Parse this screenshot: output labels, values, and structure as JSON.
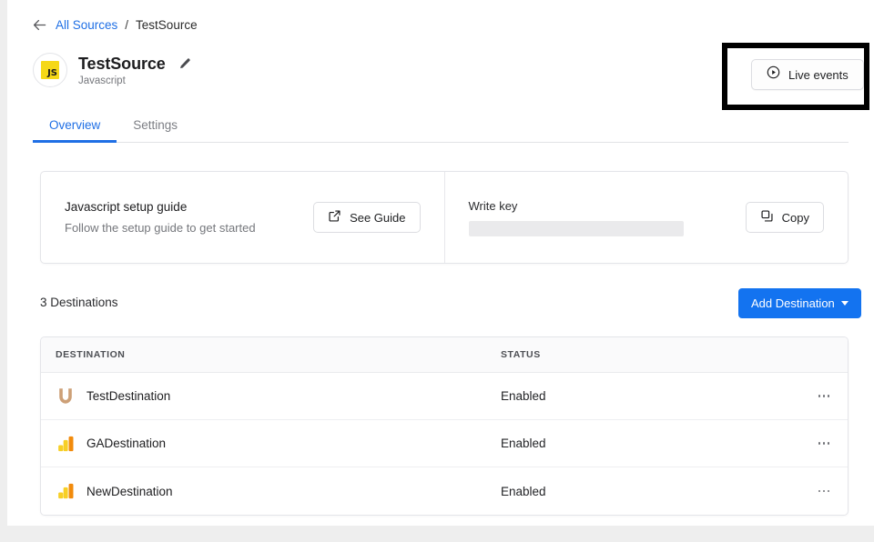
{
  "breadcrumb": {
    "back_icon": "arrow-left-icon",
    "root_label": "All Sources",
    "separator": "/",
    "current_label": "TestSource"
  },
  "source": {
    "logo_text": "JS",
    "logo_icon": "javascript-logo-icon",
    "title": "TestSource",
    "subtitle": "Javascript",
    "edit_icon": "pencil-icon"
  },
  "header_actions": {
    "live_events_label": "Live events",
    "live_events_icon": "play-circle-icon",
    "highlight_color": "#000000"
  },
  "tabs": [
    {
      "label": "Overview",
      "active": true
    },
    {
      "label": "Settings",
      "active": false
    }
  ],
  "setup_card": {
    "title": "Javascript setup guide",
    "subtitle": "Follow the setup guide to get started",
    "button_label": "See Guide",
    "button_icon": "external-link-icon"
  },
  "write_key_card": {
    "label": "Write key",
    "value": "",
    "masked": true,
    "button_label": "Copy",
    "button_icon": "copy-icon"
  },
  "destinations": {
    "count_label": "3 Destinations",
    "add_button_label": "Add Destination",
    "add_button_icon": "chevron-down-icon",
    "accent_color": "#1373f0",
    "columns": [
      "DESTINATION",
      "STATUS",
      ""
    ],
    "rows": [
      {
        "name": "TestDestination",
        "status": "Enabled",
        "logo": "vero-u-logo-icon",
        "menu_icon": "overflow-menu-icon"
      },
      {
        "name": "GADestination",
        "status": "Enabled",
        "logo": "google-analytics-logo-icon",
        "menu_icon": "overflow-menu-icon"
      },
      {
        "name": "NewDestination",
        "status": "Enabled",
        "logo": "google-analytics-logo-icon",
        "menu_icon": "overflow-menu-icon"
      }
    ]
  }
}
